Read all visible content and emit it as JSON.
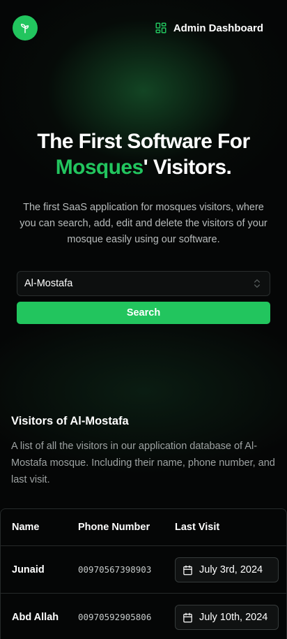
{
  "header": {
    "admin_label": "Admin Dashboard"
  },
  "hero": {
    "title_line1": "The First Software For",
    "title_highlight": "Mosques",
    "title_rest": "' Visitors.",
    "description": "The first SaaS application for mosques visitors, where you can search, add, edit and delete the visitors of your mosque easily using our software."
  },
  "search": {
    "selected_mosque": "Al-Mostafa",
    "button_label": "Search"
  },
  "visitors": {
    "title": "Visitors of Al-Mostafa",
    "description": "A list of all the visitors in our application database of Al-Mostafa mosque. Including their name, phone number, and last visit."
  },
  "table": {
    "columns": [
      "Name",
      "Phone Number",
      "Last Visit"
    ],
    "rows": [
      {
        "name": "Junaid",
        "phone": "00970567398903",
        "last_visit": "July 3rd, 2024"
      },
      {
        "name": "Abd Allah",
        "phone": "00970592905806",
        "last_visit": "July 10th, 2024"
      }
    ]
  },
  "colors": {
    "accent": "#22c55e",
    "background": "#050606"
  },
  "icons": [
    "sprout-logo-icon",
    "dashboard-grid-icon",
    "chevron-up-down-icon",
    "calendar-icon"
  ]
}
